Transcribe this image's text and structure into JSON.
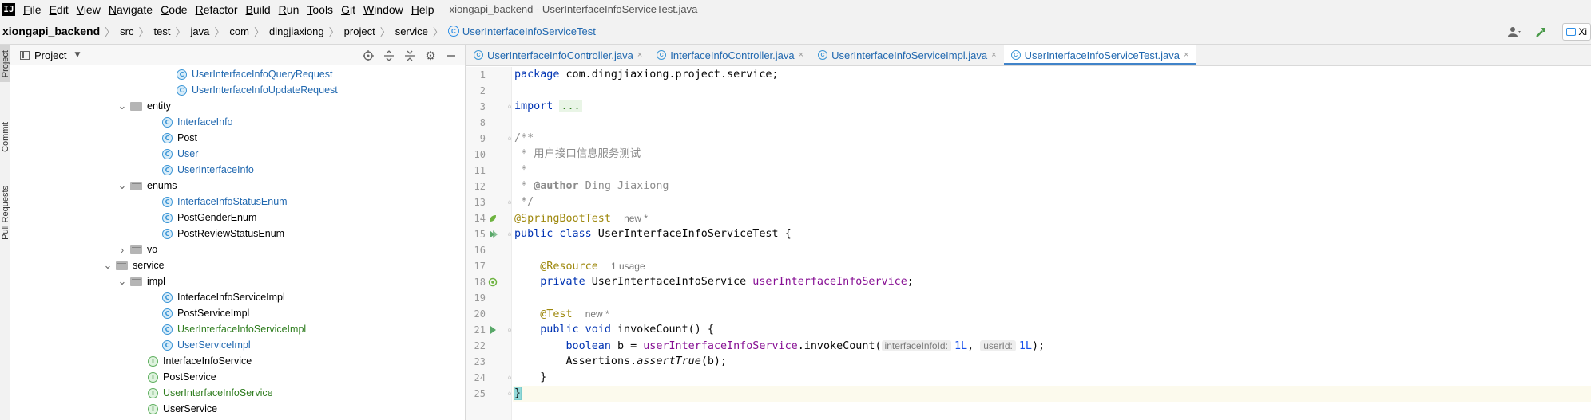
{
  "window": {
    "title": "xiongapi_backend - UserInterfaceInfoServiceTest.java",
    "logo": "IJ"
  },
  "menu": [
    "File",
    "Edit",
    "View",
    "Navigate",
    "Code",
    "Refactor",
    "Build",
    "Run",
    "Tools",
    "Git",
    "Window",
    "Help"
  ],
  "breadcrumb": {
    "project": "xiongapi_backend",
    "parts": [
      "src",
      "test",
      "java",
      "com",
      "dingjiaxiong",
      "project",
      "service"
    ],
    "file": "UserInterfaceInfoServiceTest"
  },
  "toolbar_right": {
    "user_icon": "user-icon",
    "build_icon": "hammer-icon",
    "run_config_label": "Xi"
  },
  "tool_stripe": {
    "project": "Project",
    "commit": "Commit",
    "pull_requests": "Pull Requests"
  },
  "project_panel": {
    "title": "Project",
    "tools": [
      "crosshair-icon",
      "expand-all-icon",
      "collapse-all-icon",
      "gear-icon",
      "minimize-icon"
    ],
    "tree": [
      {
        "label": "UserInterfaceInfoQueryRequest",
        "kind": "class",
        "color": "blue",
        "expand": ""
      },
      {
        "label": "UserInterfaceInfoUpdateRequest",
        "kind": "class",
        "color": "blue",
        "expand": ""
      },
      {
        "label": "entity",
        "kind": "folder",
        "color": "black",
        "expand": "open"
      },
      {
        "label": "InterfaceInfo",
        "kind": "class",
        "color": "blue",
        "expand": ""
      },
      {
        "label": "Post",
        "kind": "class",
        "color": "black",
        "expand": ""
      },
      {
        "label": "User",
        "kind": "class",
        "color": "blue",
        "expand": ""
      },
      {
        "label": "UserInterfaceInfo",
        "kind": "class",
        "color": "blue",
        "expand": ""
      },
      {
        "label": "enums",
        "kind": "folder",
        "color": "black",
        "expand": "open"
      },
      {
        "label": "InterfaceInfoStatusEnum",
        "kind": "class",
        "color": "blue",
        "expand": ""
      },
      {
        "label": "PostGenderEnum",
        "kind": "class",
        "color": "black",
        "expand": ""
      },
      {
        "label": "PostReviewStatusEnum",
        "kind": "class",
        "color": "black",
        "expand": ""
      },
      {
        "label": "vo",
        "kind": "folder",
        "color": "black",
        "expand": "closed"
      },
      {
        "label": "service",
        "kind": "folder",
        "color": "black",
        "expand": "open"
      },
      {
        "label": "impl",
        "kind": "folder",
        "color": "black",
        "expand": "open"
      },
      {
        "label": "InterfaceInfoServiceImpl",
        "kind": "class",
        "color": "black",
        "expand": ""
      },
      {
        "label": "PostServiceImpl",
        "kind": "class",
        "color": "black",
        "expand": ""
      },
      {
        "label": "UserInterfaceInfoServiceImpl",
        "kind": "class",
        "color": "green",
        "expand": ""
      },
      {
        "label": "UserServiceImpl",
        "kind": "class",
        "color": "blue",
        "expand": ""
      },
      {
        "label": "InterfaceInfoService",
        "kind": "interface",
        "color": "black",
        "expand": ""
      },
      {
        "label": "PostService",
        "kind": "interface",
        "color": "black",
        "expand": ""
      },
      {
        "label": "UserInterfaceInfoService",
        "kind": "interface",
        "color": "green",
        "expand": ""
      },
      {
        "label": "UserService",
        "kind": "interface",
        "color": "black",
        "expand": ""
      }
    ]
  },
  "tabs": [
    {
      "label": "UserInterfaceInfoController.java",
      "close": "×",
      "active": false
    },
    {
      "label": "InterfaceInfoController.java",
      "close": "×",
      "active": false
    },
    {
      "label": "UserInterfaceInfoServiceImpl.java",
      "close": "×",
      "active": false
    },
    {
      "label": "UserInterfaceInfoServiceTest.java",
      "close": "×",
      "active": true
    }
  ],
  "code": {
    "line_numbers": [
      "1",
      "2",
      "3",
      "8",
      "9",
      "10",
      "11",
      "12",
      "13",
      "14",
      "15",
      "16",
      "17",
      "18",
      "19",
      "20",
      "21",
      "22",
      "23",
      "24",
      "25"
    ],
    "line1_kw": "package",
    "line1_rest": " com.dingjiaxiong.project.service;",
    "line3_kw": "import",
    "line3_folded": "...",
    "line9": "/**",
    "line10": " * 用户接口信息服务测试",
    "line11": " *",
    "line12_pre": " * ",
    "line12_tag": "@author",
    "line12_rest": " Ding Jiaxiong",
    "line13": " */",
    "line14_ann": "@SpringBootTest",
    "line14_hint": "new *",
    "line15_kw": "public class",
    "line15_rest": " UserInterfaceInfoServiceTest {",
    "line17_ann": "@Resource",
    "line17_hint": "1 usage",
    "line18_kw": "private",
    "line18_type": " UserInterfaceInfoService ",
    "line18_field": "userInterfaceInfoService",
    "line18_end": ";",
    "line20_ann": "@Test",
    "line20_hint": "new *",
    "line21_kw": "public void",
    "line21_rest": " invokeCount() {",
    "line22_kw": "boolean",
    "line22_a": " b = ",
    "line22_field": "userInterfaceInfoService",
    "line22_b": ".invokeCount(",
    "line22_hint1": "interfaceInfoId:",
    "line22_num1": "1L",
    "line22_comma": ", ",
    "line22_hint2": "userId:",
    "line22_num2": "1L",
    "line22_end": ");",
    "line23_a": "Assertions.",
    "line23_call": "assertTrue",
    "line23_end": "(b);",
    "line24": "}",
    "line25": "}"
  }
}
